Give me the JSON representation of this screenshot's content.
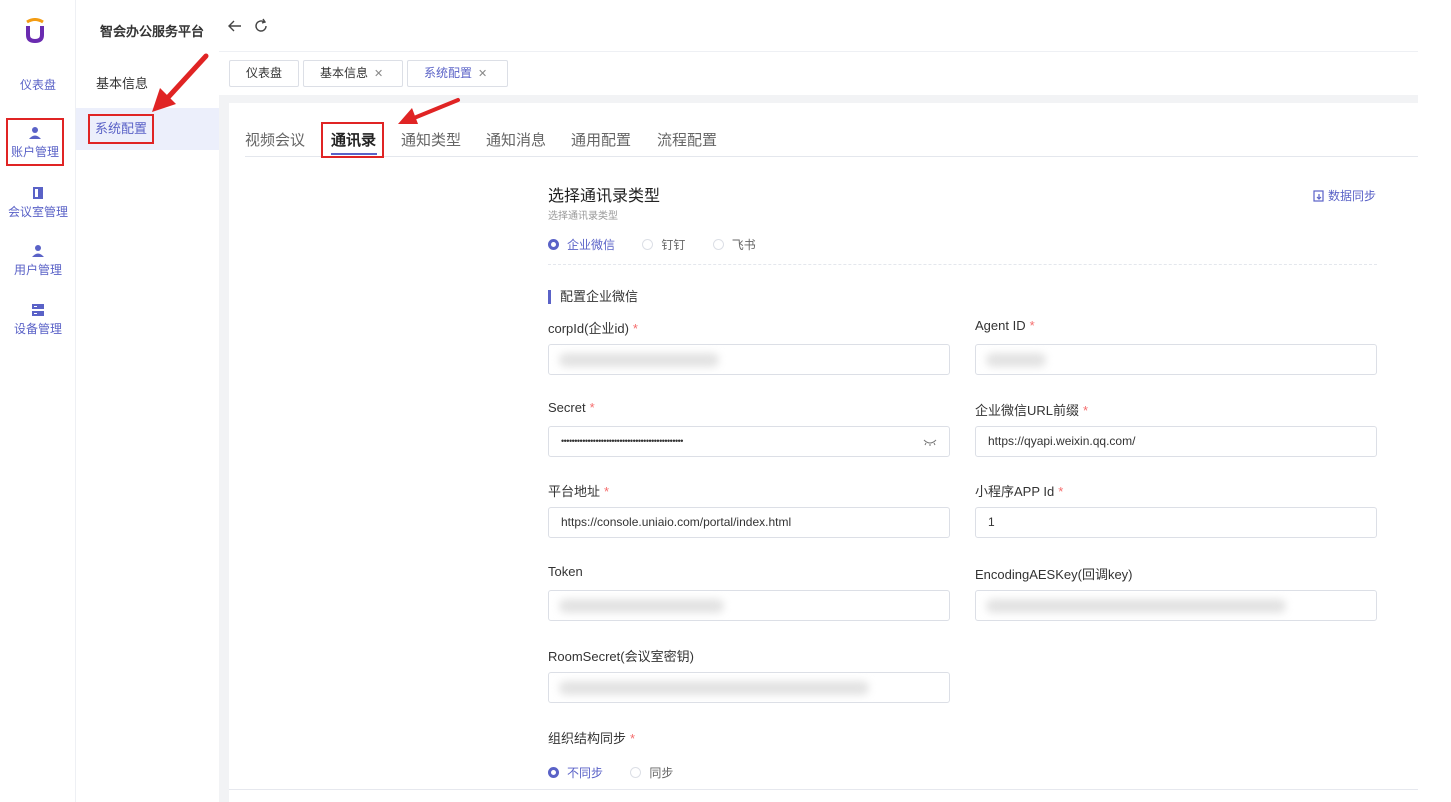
{
  "rail": {
    "items": [
      {
        "label": "仪表盘"
      },
      {
        "label": "账户管理"
      },
      {
        "label": "会议室管理"
      },
      {
        "label": "用户管理"
      },
      {
        "label": "设备管理"
      }
    ]
  },
  "sidebar": {
    "brand": "智会办公服务平台",
    "items": [
      {
        "label": "基本信息"
      },
      {
        "label": "系统配置"
      }
    ]
  },
  "tags": [
    {
      "label": "仪表盘"
    },
    {
      "label": "基本信息"
    },
    {
      "label": "系统配置"
    }
  ],
  "tabs": [
    {
      "label": "视频会议"
    },
    {
      "label": "通讯录"
    },
    {
      "label": "通知类型"
    },
    {
      "label": "通知消息"
    },
    {
      "label": "通用配置"
    },
    {
      "label": "流程配置"
    }
  ],
  "form": {
    "title": "选择通讯录类型",
    "subtitle": "选择通讯录类型",
    "sync_label": "数据同步",
    "types": [
      {
        "label": "企业微信",
        "selected": true
      },
      {
        "label": "钉钉",
        "selected": false
      },
      {
        "label": "飞书",
        "selected": false
      }
    ],
    "group_title": "配置企业微信",
    "fields": {
      "corpid": {
        "label": "corpId(企业id)",
        "required": "*",
        "value": ""
      },
      "agentid": {
        "label": "Agent ID",
        "required": "*",
        "value": ""
      },
      "secret": {
        "label": "Secret",
        "required": "*",
        "value": "••••••••••••••••••••••••••••••••••••••••••••••"
      },
      "wx_url": {
        "label": "企业微信URL前缀",
        "required": "*",
        "value": "https://qyapi.weixin.qq.com/"
      },
      "platform": {
        "label": "平台地址",
        "required": "*",
        "value": "https://console.uniaio.com/portal/index.html"
      },
      "mini_app": {
        "label": "小程序APP Id",
        "required": "*",
        "value": "1"
      },
      "token": {
        "label": "Token",
        "value": ""
      },
      "aeskey": {
        "label": "EncodingAESKey(回调key)",
        "value": ""
      },
      "roomsecret": {
        "label": "RoomSecret(会议室密钥)",
        "value": ""
      }
    },
    "org_sync": {
      "label": "组织结构同步",
      "required": "*",
      "options": [
        {
          "label": "不同步",
          "selected": true
        },
        {
          "label": "同步",
          "selected": false
        }
      ]
    }
  },
  "colors": {
    "accent": "#5a62c7",
    "annotation_red": "#e02424",
    "required": "#f56c6c"
  }
}
